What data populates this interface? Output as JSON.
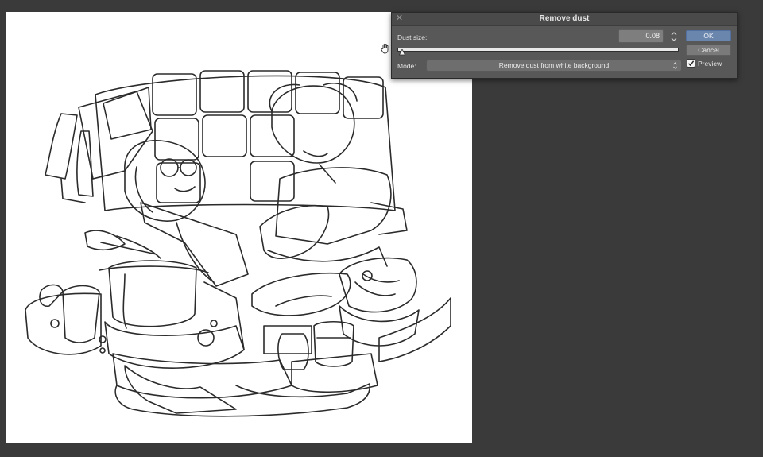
{
  "dialog": {
    "title": "Remove dust",
    "dust_size_label": "Dust size:",
    "dust_size_value": "0.08",
    "slider_value": 0.08,
    "mode_label": "Mode:",
    "mode_value": "Remove dust from white background",
    "ok_label": "OK",
    "cancel_label": "Cancel",
    "preview_label": "Preview",
    "preview_checked": true
  },
  "icons": {
    "close": "close-icon",
    "stepper": "stepper-arrows-icon",
    "select": "select-arrows-icon",
    "cursor": "hand-cursor-icon"
  },
  "colors": {
    "workspace": "#3a3a3a",
    "dialog_bg": "#585858",
    "ok_button": "#6a86ad",
    "canvas": "#ffffff"
  }
}
